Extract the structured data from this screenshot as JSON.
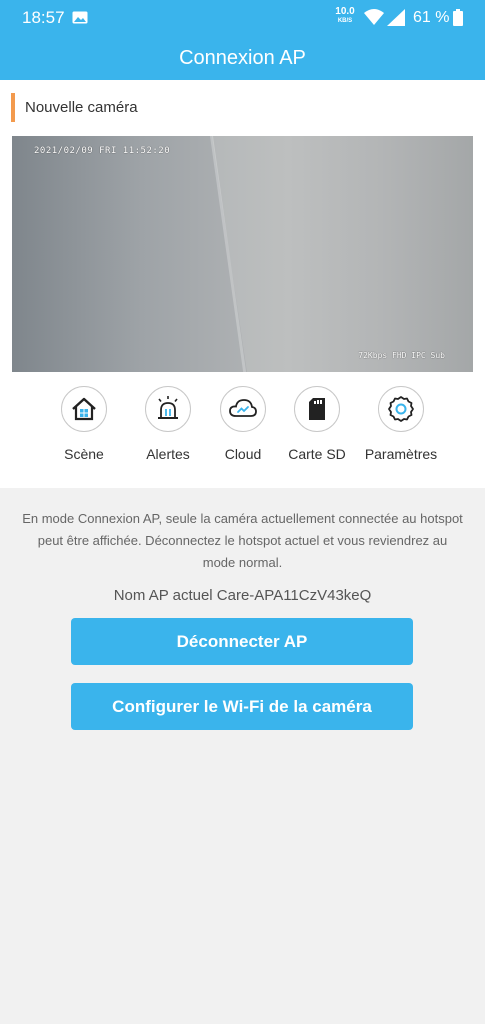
{
  "status_bar": {
    "time": "18:57",
    "net_speed_value": "10.0",
    "net_speed_unit": "KB/S",
    "battery": "61 %",
    "icons": [
      "image-icon",
      "wifi-icon",
      "signal-icon",
      "battery-icon"
    ]
  },
  "header": {
    "title": "Connexion AP"
  },
  "camera": {
    "name": "Nouvelle caméra",
    "osd_timestamp": "2021/02/09  FRI 11:52:20",
    "osd_info": "72Kbps FHD IPC Sub"
  },
  "actions": [
    {
      "label": "Scène",
      "icon": "home-icon"
    },
    {
      "label": "Alertes",
      "icon": "alarm-icon"
    },
    {
      "label": "Cloud",
      "icon": "cloud-icon"
    },
    {
      "label": "Carte SD",
      "icon": "sd-card-icon"
    },
    {
      "label": "Paramètres",
      "icon": "gear-icon"
    }
  ],
  "info": {
    "message": "En mode Connexion AP, seule la caméra actuellement connectée au hotspot peut être affichée. Déconnectez le hotspot actuel et vous reviendrez au mode normal.",
    "ap_name": "Nom AP actuel Care-APA11CzV43keQ"
  },
  "buttons": {
    "disconnect": "Déconnecter AP",
    "configure_wifi": "Configurer le Wi-Fi de la caméra"
  },
  "colors": {
    "accent": "#3ab4ec",
    "title_marker": "#f39a4d",
    "background": "#f1f1f1"
  }
}
